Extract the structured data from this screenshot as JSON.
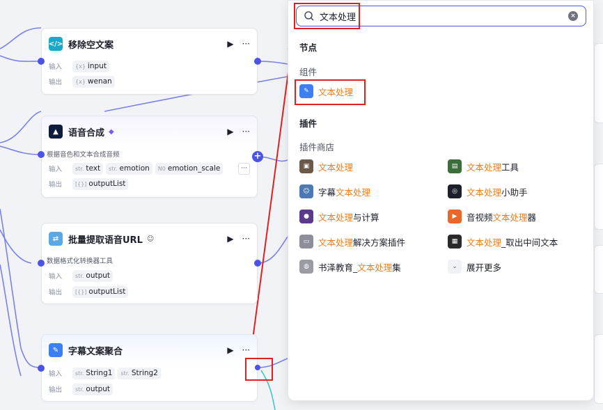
{
  "nodes": {
    "remove_empty": {
      "title": "移除空文案",
      "input_label": "输入",
      "output_label": "输出",
      "input_type": "{x}",
      "input_name": "input",
      "output_type": "{x}",
      "output_name": "wenan"
    },
    "tts": {
      "title": "语音合成",
      "badge": "◆",
      "description": "根据音色和文本合成音频",
      "input_label": "输入",
      "output_label": "输出",
      "inputs": [
        {
          "type": "str.",
          "name": "text"
        },
        {
          "type": "str.",
          "name": "emotion"
        },
        {
          "type": "N0",
          "name": "emotion_scale"
        }
      ],
      "more_label": "···",
      "output_type": "[{}]",
      "output_name": "outputList"
    },
    "batch_extract": {
      "title": "批量提取语音URL",
      "description": "数据格式化转换器工具",
      "input_label": "输入",
      "output_label": "输出",
      "input_type": "str.",
      "input_name": "output",
      "output_type": "[{}]",
      "output_name": "outputList"
    },
    "subtitle_merge": {
      "title": "字幕文案聚合",
      "input_label": "输入",
      "output_label": "输出",
      "inputs": [
        {
          "type": "str.",
          "name": "String1"
        },
        {
          "type": "str.",
          "name": "String2"
        }
      ],
      "output_type": "str.",
      "output_name": "output"
    }
  },
  "node_actions": {
    "run": "▶",
    "more": "···"
  },
  "panel": {
    "search_value": "文本处理",
    "section_nodes": "节点",
    "section_components": "组件",
    "component_item": "文本处理",
    "section_plugins": "插件",
    "plugin_store": "插件商店",
    "expand_more": "展开更多",
    "plugins": [
      {
        "pre": "",
        "hl": "文本处理",
        "post": "",
        "icon": "photo-icon",
        "color": "#6b5a4a"
      },
      {
        "pre": "",
        "hl": "文本处理",
        "post": "工具",
        "icon": "poster-icon",
        "color": "#3b6e3a"
      },
      {
        "pre": "字幕",
        "hl": "文本处理",
        "post": "",
        "icon": "avatar-icon",
        "color": "#4a79b8"
      },
      {
        "pre": "",
        "hl": "文本处理",
        "post": "小助手",
        "icon": "ring-icon",
        "color": "#1d1f2a"
      },
      {
        "pre": "",
        "hl": "文本处理",
        "post": "与计算",
        "icon": "sphere-icon",
        "color": "#5b3a8a"
      },
      {
        "pre": "音视频",
        "hl": "文本处理",
        "post": "器",
        "icon": "flag-icon",
        "color": "#e8672a"
      },
      {
        "pre": "",
        "hl": "文本处理",
        "post": "解决方案插件",
        "icon": "monitor-icon",
        "color": "#8c8f99"
      },
      {
        "pre": "",
        "hl": "文本处理",
        "post": "_取出中间文本",
        "icon": "noise-icon",
        "color": "#2a2a2a"
      },
      {
        "pre": "书泽教育_",
        "hl": "文本处理",
        "post": "集",
        "icon": "globe-icon",
        "color": "#9a9ca4"
      }
    ]
  }
}
